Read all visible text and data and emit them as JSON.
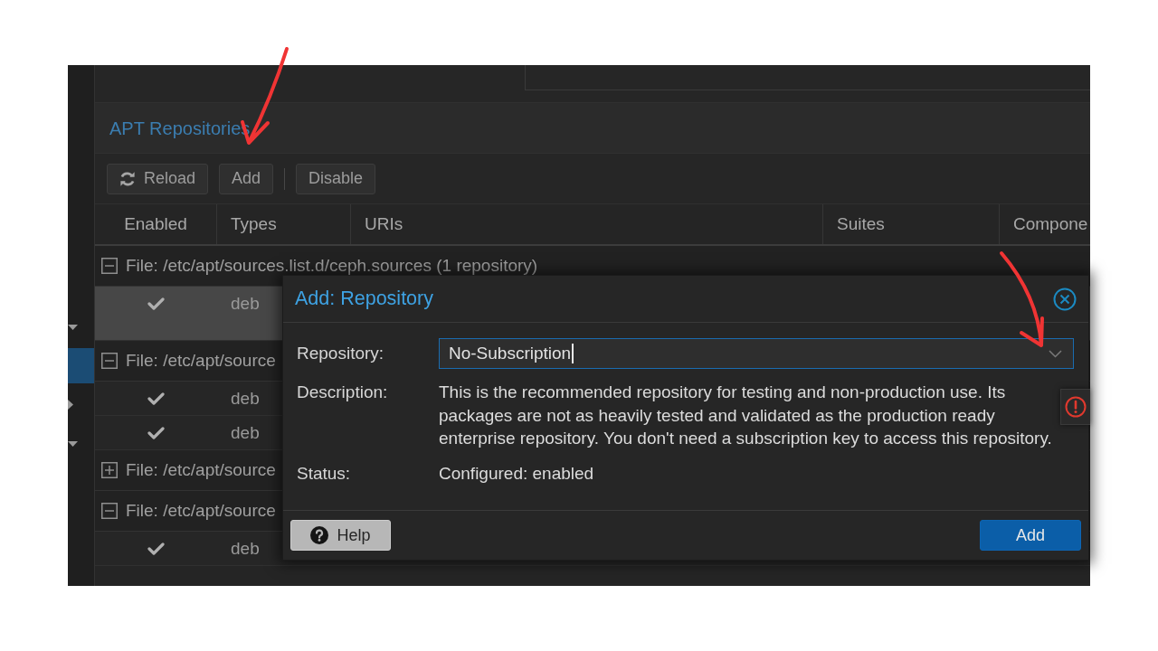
{
  "sidebar": {
    "items": [
      {
        "kind": "node",
        "expanded": true,
        "selected": false
      },
      {
        "kind": "leaf",
        "selected": true
      },
      {
        "kind": "node",
        "expanded": false,
        "selected": false
      },
      {
        "kind": "node",
        "expanded": true,
        "selected": false
      }
    ]
  },
  "panel": {
    "title": "APT Repositories",
    "toolbar": [
      {
        "kind": "icon-button",
        "label": "Reload"
      },
      {
        "kind": "button",
        "label": "Add"
      },
      {
        "kind": "separator"
      },
      {
        "kind": "button",
        "label": "Disable"
      }
    ]
  },
  "table": {
    "columns": [
      "Enabled",
      "Types",
      "URIs",
      "Suites",
      "Compone"
    ],
    "groups": [
      {
        "label": "File: /etc/apt/sources.list.d/ceph.sources (1 repository)",
        "expanded": true,
        "rows": [
          {
            "enabled": true,
            "type": "deb",
            "selected": true
          }
        ]
      },
      {
        "label": "File: /etc/apt/source",
        "expanded": true,
        "rows": [
          {
            "enabled": true,
            "type": "deb",
            "selected": false
          },
          {
            "enabled": true,
            "type": "deb",
            "selected": false
          }
        ]
      },
      {
        "label": "File: /etc/apt/source",
        "expanded": false
      },
      {
        "label": "File: /etc/apt/source",
        "expanded": true,
        "rows": [
          {
            "enabled": true,
            "type": "deb",
            "selected": false
          }
        ]
      }
    ]
  },
  "dialog": {
    "title": "Add: Repository",
    "invalid": true,
    "fields": [
      {
        "kind": "combobox",
        "label": "Repository:",
        "value": "No-Subscription",
        "focused": true
      },
      {
        "kind": "text",
        "label": "Description:",
        "value": "This is the recommended repository for testing and non-production use. Its packages are not as heavily tested and validated as the production ready enterprise repository. You don't need a subscription key to access this repository."
      },
      {
        "kind": "text",
        "label": "Status:",
        "value": "Configured: enabled"
      }
    ],
    "buttons": [
      {
        "kind": "help",
        "label": "Help"
      },
      {
        "kind": "primary",
        "label": "Add"
      }
    ]
  }
}
